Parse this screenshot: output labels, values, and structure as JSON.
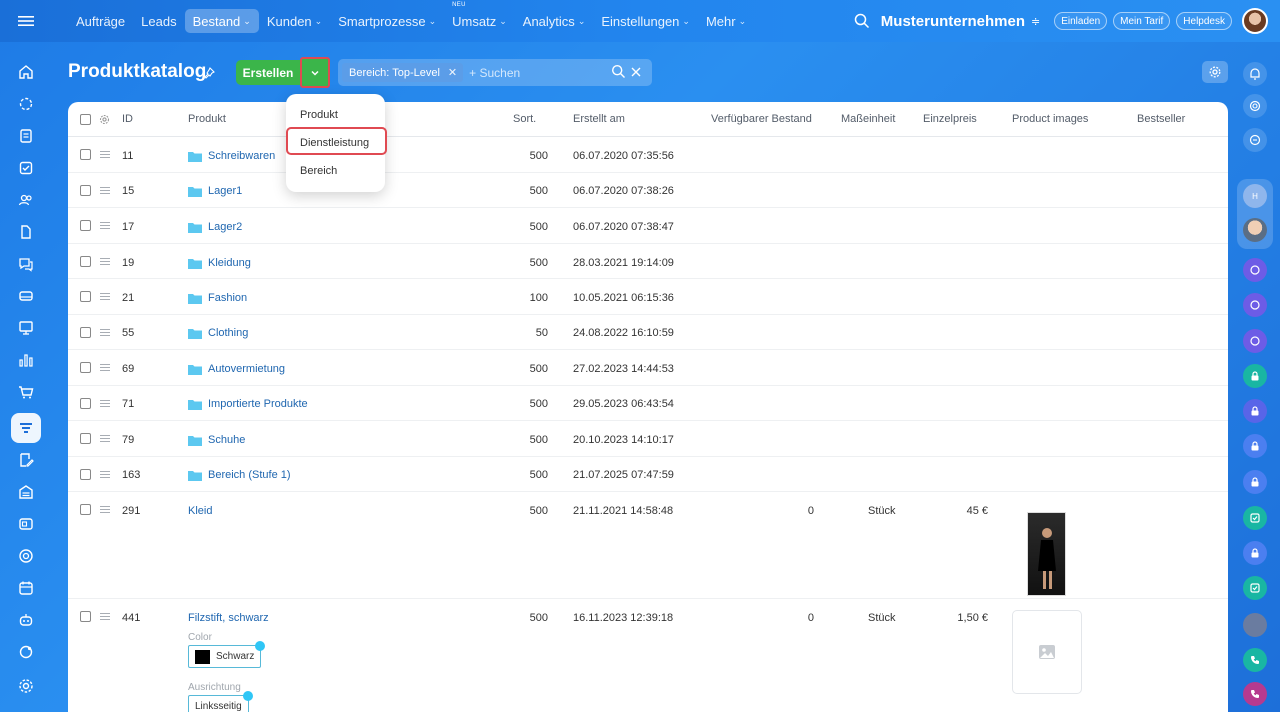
{
  "topbar": {
    "nav": [
      {
        "label": "Aufträge",
        "has_menu": false
      },
      {
        "label": "Leads",
        "has_menu": false
      },
      {
        "label": "Bestand",
        "has_menu": true,
        "active": true
      },
      {
        "label": "Kunden",
        "has_menu": true
      },
      {
        "label": "Smartprozesse",
        "has_menu": true
      },
      {
        "label": "Umsatz",
        "has_menu": true,
        "badge": "NEU"
      },
      {
        "label": "Analytics",
        "has_menu": true
      },
      {
        "label": "Einstellungen",
        "has_menu": true
      },
      {
        "label": "Mehr",
        "has_menu": true
      }
    ],
    "chevron": "⌄",
    "company": "Musterunternehmen",
    "buttons": [
      "Einladen",
      "Mein Tarif",
      "Helpdesk"
    ]
  },
  "page": {
    "title": "Produktkatalog",
    "create_label": "Erstellen",
    "filter": {
      "tag": "Bereich: Top-Level",
      "placeholder": "+ Suchen"
    }
  },
  "dropdown": {
    "items": [
      "Produkt",
      "Dienstleistung",
      "Bereich"
    ],
    "highlighted": "Dienstleistung"
  },
  "table": {
    "columns": [
      "ID",
      "Produkt",
      "Sort.",
      "Erstellt am",
      "Verfügbarer Bestand",
      "Maßeinheit",
      "Einzelpreis",
      "Product images",
      "Bestseller"
    ],
    "rows": [
      {
        "id": "11",
        "name": "Schreibwaren",
        "folder": true,
        "sort": "500",
        "created": "06.07.2020 07:35:56"
      },
      {
        "id": "15",
        "name": "Lager1",
        "folder": true,
        "sort": "500",
        "created": "06.07.2020 07:38:26"
      },
      {
        "id": "17",
        "name": "Lager2",
        "folder": true,
        "sort": "500",
        "created": "06.07.2020 07:38:47"
      },
      {
        "id": "19",
        "name": "Kleidung",
        "folder": true,
        "sort": "500",
        "created": "28.03.2021 19:14:09"
      },
      {
        "id": "21",
        "name": "Fashion",
        "folder": true,
        "sort": "100",
        "created": "10.05.2021 06:15:36"
      },
      {
        "id": "55",
        "name": "Clothing",
        "folder": true,
        "sort": "50",
        "created": "24.08.2022 16:10:59"
      },
      {
        "id": "69",
        "name": "Autovermietung",
        "folder": true,
        "sort": "500",
        "created": "27.02.2023 14:44:53"
      },
      {
        "id": "71",
        "name": "Importierte Produkte",
        "folder": true,
        "sort": "500",
        "created": "29.05.2023 06:43:54"
      },
      {
        "id": "79",
        "name": "Schuhe",
        "folder": true,
        "sort": "500",
        "created": "20.10.2023 14:10:17"
      },
      {
        "id": "163",
        "name": "Bereich (Stufe 1)",
        "folder": true,
        "sort": "500",
        "created": "21.07.2025 07:47:59"
      },
      {
        "id": "291",
        "name": "Kleid",
        "folder": false,
        "sort": "500",
        "created": "21.11.2021 14:58:48",
        "stock": "0",
        "unit": "Stück",
        "price": "45 €"
      },
      {
        "id": "441",
        "name": "Filzstift, schwarz",
        "folder": false,
        "sort": "500",
        "created": "16.11.2023 12:39:18",
        "stock": "0",
        "unit": "Stück",
        "price": "1,50 €",
        "attrs": [
          {
            "label": "Color",
            "value": "Schwarz"
          },
          {
            "label": "Ausrichtung",
            "value": "Linksseitig"
          }
        ]
      }
    ]
  },
  "colors": {
    "accent_green": "#3bb54a",
    "highlight_red": "#e04a52",
    "link_blue": "#2067b0"
  }
}
